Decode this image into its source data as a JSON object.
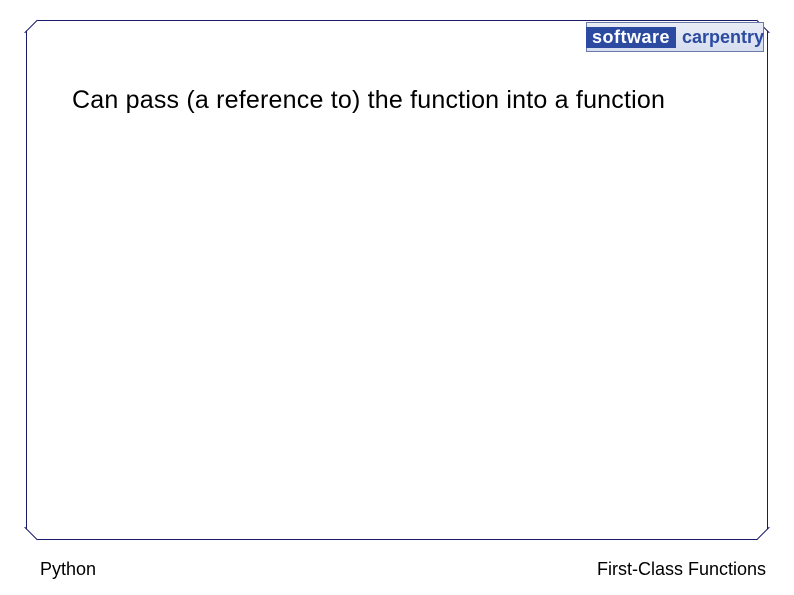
{
  "logo": {
    "word1": "software",
    "word2": "carpentry"
  },
  "headline": "Can pass (a reference to) the function into a function",
  "footer": {
    "left": "Python",
    "right": "First-Class Functions"
  }
}
